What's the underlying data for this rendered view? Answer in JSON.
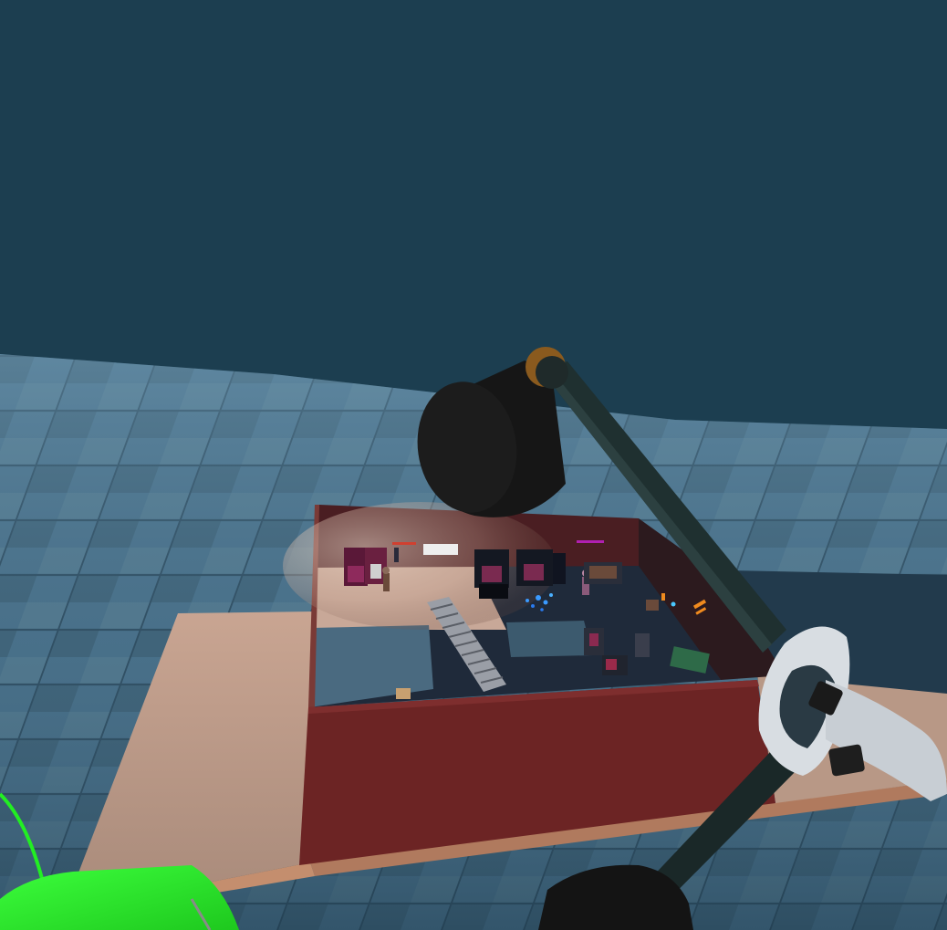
{
  "scene": {
    "sky_color": "#1c3e50",
    "floor_color": "#4a6e84",
    "table_top_color": "#b89886",
    "model_wall_color": "#6c2424",
    "model_floor_color": "#1f2a3a",
    "accent_green": "#22dd22",
    "lamp_color": "#1a1a1a",
    "lamp_pivot_color": "#8a5a1e",
    "arm_color": "#1f3030",
    "controller_color": "#d8dde2"
  },
  "model": {
    "sign_text": "",
    "red_sign_text": "",
    "magenta_sign_text": ""
  }
}
